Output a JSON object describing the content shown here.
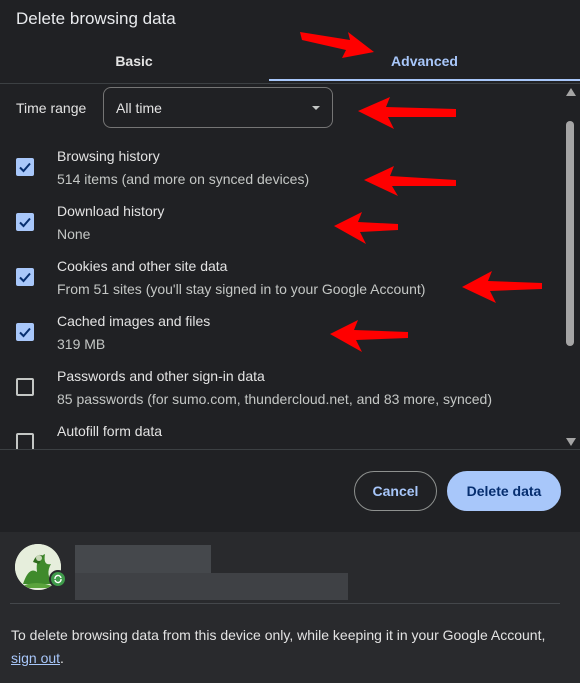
{
  "dialog": {
    "title": "Delete browsing data"
  },
  "tabs": [
    {
      "label": "Basic",
      "selected": false
    },
    {
      "label": "Advanced",
      "selected": true
    }
  ],
  "time_range": {
    "label": "Time range",
    "value": "All time"
  },
  "items": [
    {
      "label": "Browsing history",
      "detail": "514 items (and more on synced devices)",
      "checked": true
    },
    {
      "label": "Download history",
      "detail": "None",
      "checked": true
    },
    {
      "label": "Cookies and other site data",
      "detail": "From 51 sites (you'll stay signed in to your Google Account)",
      "checked": true
    },
    {
      "label": "Cached images and files",
      "detail": "319 MB",
      "checked": true
    },
    {
      "label": "Passwords and other sign-in data",
      "detail": "85 passwords (for sumo.com, thundercloud.net, and 83 more, synced)",
      "checked": false
    },
    {
      "label": "Autofill form data",
      "detail": "",
      "checked": false
    }
  ],
  "buttons": {
    "cancel": "Cancel",
    "delete": "Delete data"
  },
  "footer": {
    "note_prefix": "To delete browsing data from this device only, while keeping it in your Google Account, ",
    "link": "sign out",
    "note_suffix": "."
  },
  "colors": {
    "accent": "#a8c7fa",
    "background": "#202124",
    "annotation_arrow": "#ff0000"
  }
}
